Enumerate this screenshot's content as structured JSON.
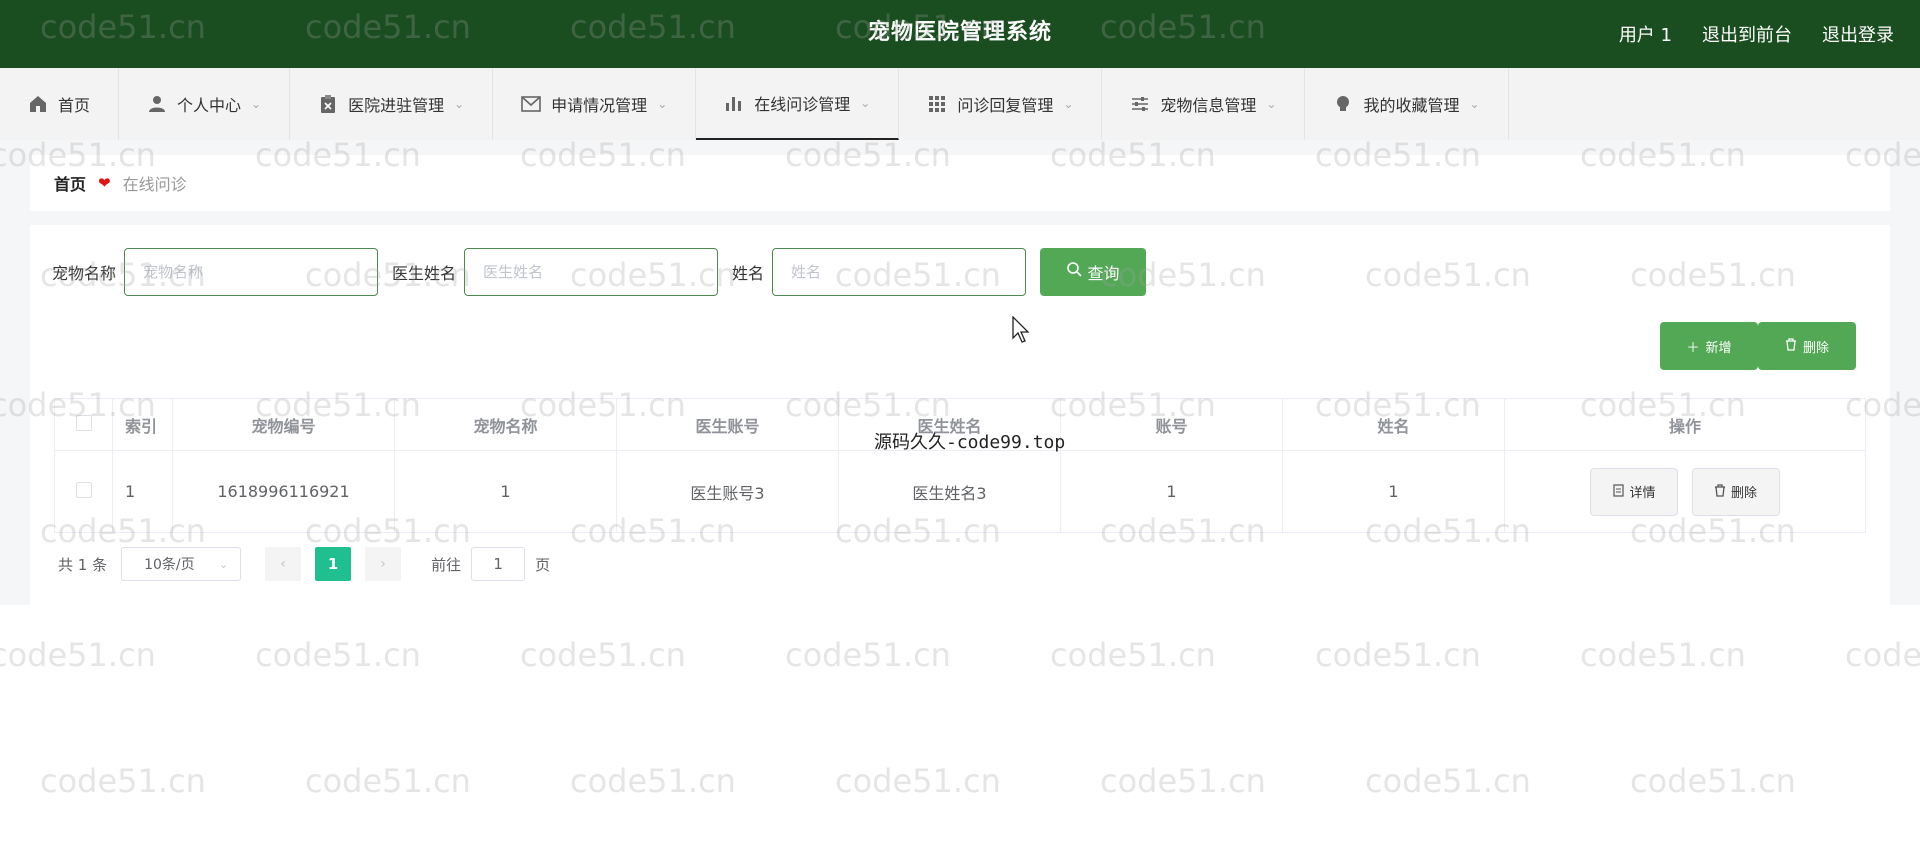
{
  "header": {
    "title": "宠物医院管理系统",
    "links": [
      "用户 1",
      "退出到前台",
      "退出登录"
    ]
  },
  "nav": [
    {
      "label": "首页",
      "icon": "home-icon"
    },
    {
      "label": "个人中心",
      "icon": "user-icon"
    },
    {
      "label": "医院进驻管理",
      "icon": "clipboard-icon"
    },
    {
      "label": "申请情况管理",
      "icon": "mail-icon"
    },
    {
      "label": "在线问诊管理",
      "icon": "bar-chart-icon",
      "active": true
    },
    {
      "label": "问诊回复管理",
      "icon": "grid-icon"
    },
    {
      "label": "宠物信息管理",
      "icon": "sliders-icon"
    },
    {
      "label": "我的收藏管理",
      "icon": "bulb-icon"
    }
  ],
  "breadcrumb": {
    "home": "首页",
    "current": "在线问诊"
  },
  "search": {
    "fields": [
      {
        "label": "宠物名称",
        "placeholder": "宠物名称"
      },
      {
        "label": "医生姓名",
        "placeholder": "医生姓名"
      },
      {
        "label": "姓名",
        "placeholder": "姓名"
      }
    ],
    "query_label": "查询"
  },
  "actions": {
    "add_label": "新增",
    "delete_label": "删除"
  },
  "table": {
    "columns": [
      "索引",
      "宠物编号",
      "宠物名称",
      "医生账号",
      "医生姓名",
      "账号",
      "姓名",
      "操作"
    ],
    "rows": [
      [
        "1",
        "1618996116921",
        "1",
        "医生账号3",
        "医生姓名3",
        "1",
        "1"
      ]
    ],
    "row_actions": {
      "detail": "详情",
      "delete": "删除"
    }
  },
  "pager": {
    "total": "共 1 条",
    "page_size": "10条/页",
    "current_page": "1",
    "goto_prefix": "前往",
    "goto_value": "1",
    "goto_suffix": "页"
  },
  "overlay_text": "源码久久-code99.top",
  "watermark": "code51.cn",
  "colors": {
    "header": "#1a4d1f",
    "accent": "#53a856",
    "page_active": "#1fbf8f"
  }
}
